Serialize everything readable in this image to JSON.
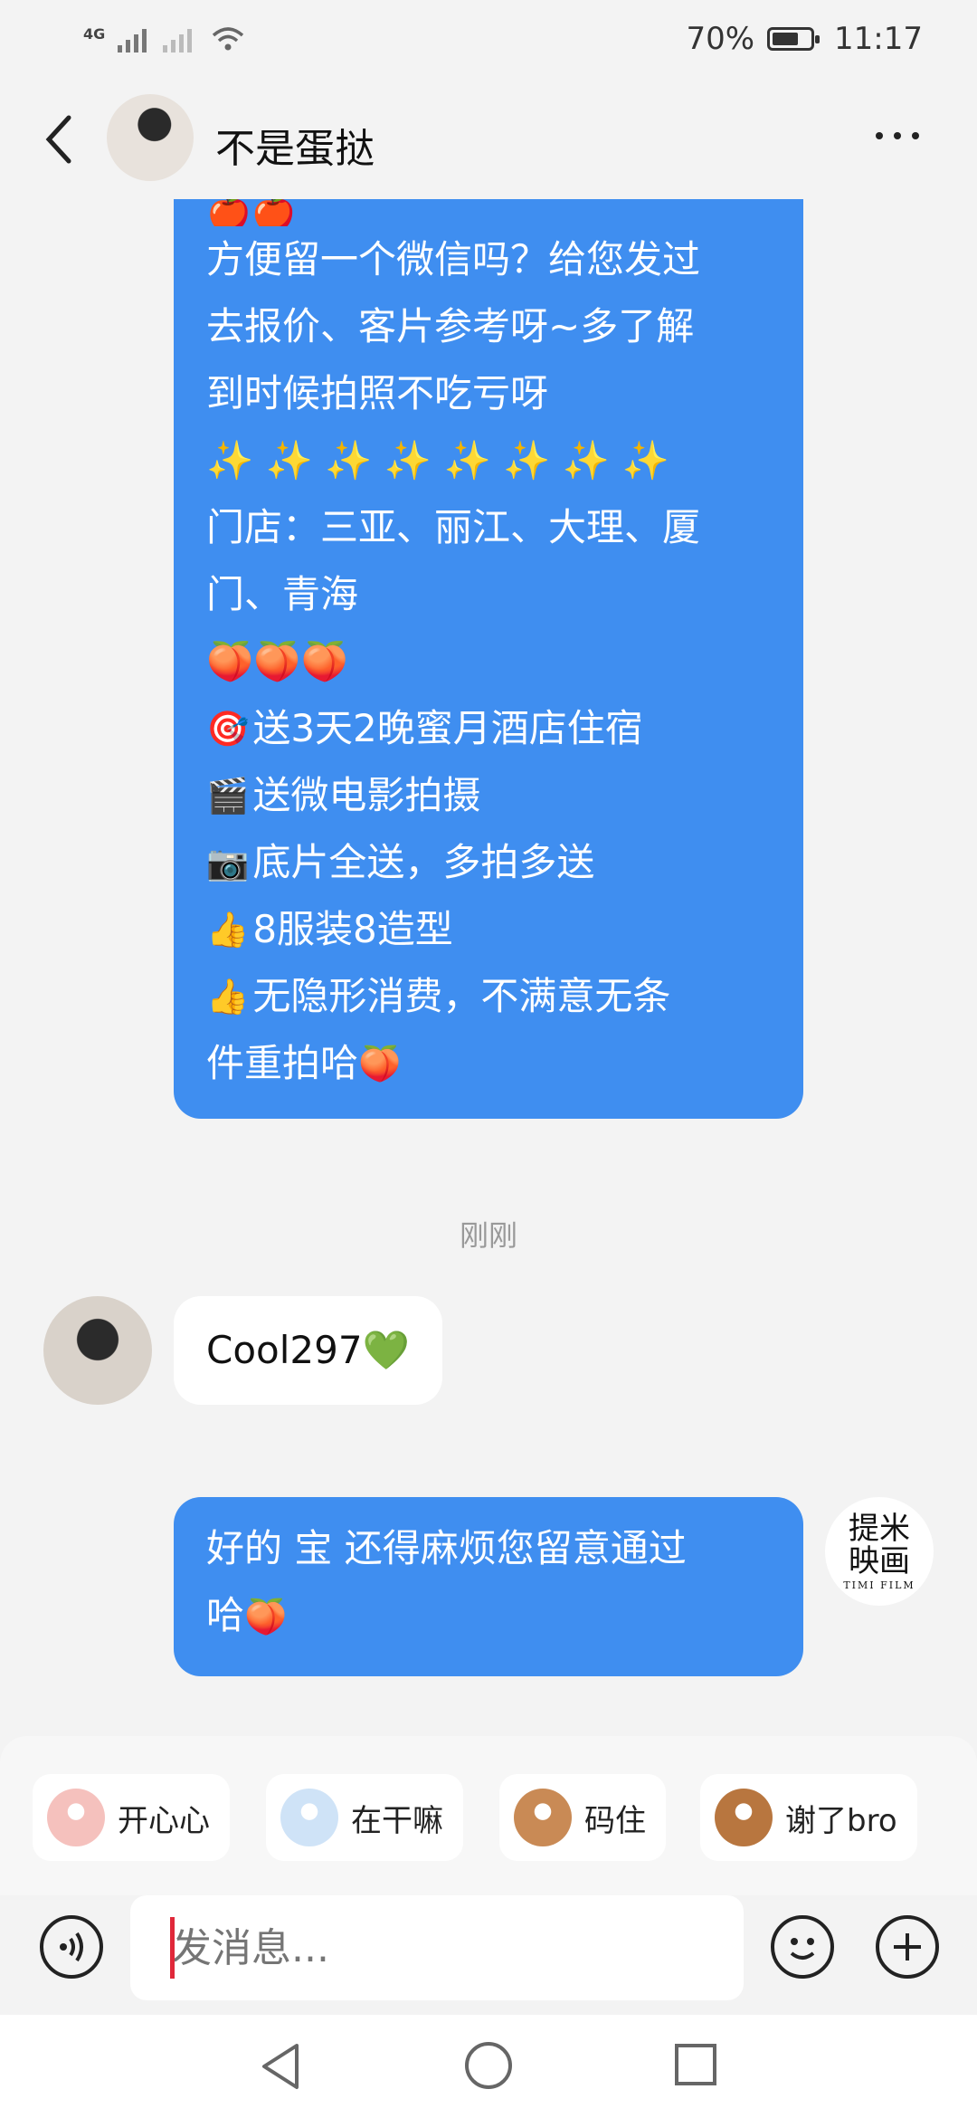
{
  "status_bar": {
    "network": "4G",
    "battery": "70%",
    "battery_level": 0.7,
    "time": "11:17"
  },
  "header": {
    "contact_name": "不是蛋挞"
  },
  "messages": {
    "msg1_lines": [
      "方便留一个微信吗？给您发过",
      "去报价、客片参考呀~多了解",
      "到时候拍照不吃亏呀",
      "✨ ✨ ✨ ✨ ✨ ✨ ✨ ✨",
      "门店：三亚、丽江、大理、厦",
      "门、青海",
      "🍑🍑🍑",
      "送3天2晚蜜月酒店住宿",
      "送微电影拍摄",
      "底片全送，多拍多送",
      "8服装8造型",
      "无隐形消费，不满意无条",
      "件重拍哈"
    ],
    "timestamp": "刚刚",
    "msg2": "Cool297💚",
    "msg3_line1": "好的 宝 还得麻烦您留意通过",
    "msg3_line2": "哈"
  },
  "my_avatar": {
    "line1": "提米",
    "line2": "映画",
    "line3": "TIMI FILM"
  },
  "quick_replies": [
    {
      "label": "开心心",
      "face_color": "#f5c1bd"
    },
    {
      "label": "在干嘛",
      "face_color": "#cfe3f7"
    },
    {
      "label": "码住",
      "face_color": "#c98a55"
    },
    {
      "label": "谢了bro",
      "face_color": "#b8763f"
    }
  ],
  "input": {
    "placeholder": "发消息..."
  },
  "icons": {
    "back": "chevron-left-icon",
    "more": "more-dots-icon",
    "voice": "voice-icon",
    "emoji": "smiley-icon",
    "plus": "plus-icon"
  }
}
